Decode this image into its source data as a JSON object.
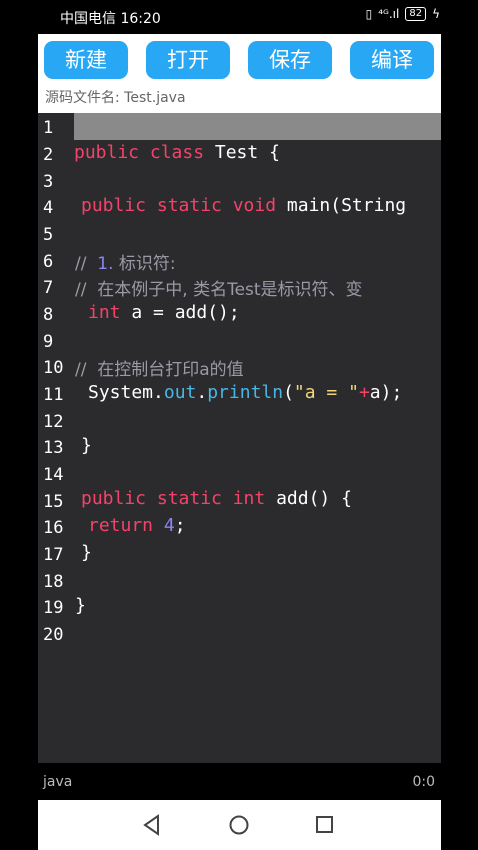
{
  "status": {
    "carrier": "中国电信",
    "time": "16:20",
    "battery": "82"
  },
  "toolbar": {
    "new_label": "新建",
    "open_label": "打开",
    "save_label": "保存",
    "compile_label": "编译"
  },
  "file": {
    "label": "源码文件名:",
    "name": "Test.java"
  },
  "editor": {
    "line_numbers": [
      "1",
      "2",
      "3",
      "4",
      "5",
      "6",
      "7",
      "8",
      "9",
      "10",
      "11",
      "12",
      "13",
      "14",
      "15",
      "16",
      "17",
      "18",
      "19",
      "20"
    ],
    "tokens": {
      "l2_kw": "public class",
      "l2_rest": " Test {",
      "l4_kw": "public static void",
      "l4_rest": " main(String",
      "l6_c1": "//  ",
      "l6_num": "1.",
      "l6_c2": " 标识符:",
      "l7": "//  在本例子中, 类名Test是标识符、变",
      "l8_kw": "int",
      "l8_rest": " a = add();",
      "l10": "//  在控制台打印a的值",
      "l11_a": "System.",
      "l11_out": "out",
      "l11_b": ".",
      "l11_fn": "println",
      "l11_c": "(",
      "l11_str": "\"a = \"",
      "l11_plus": "+",
      "l11_d": "a);",
      "l13": "}",
      "l15_kw": "public static int",
      "l15_rest": " add() {",
      "l16_kw": "return",
      "l16_num": "4",
      "l16_rest": ";",
      "l17": "}",
      "l19": "}"
    }
  },
  "footer": {
    "language": "java",
    "cursor": "0:0"
  }
}
